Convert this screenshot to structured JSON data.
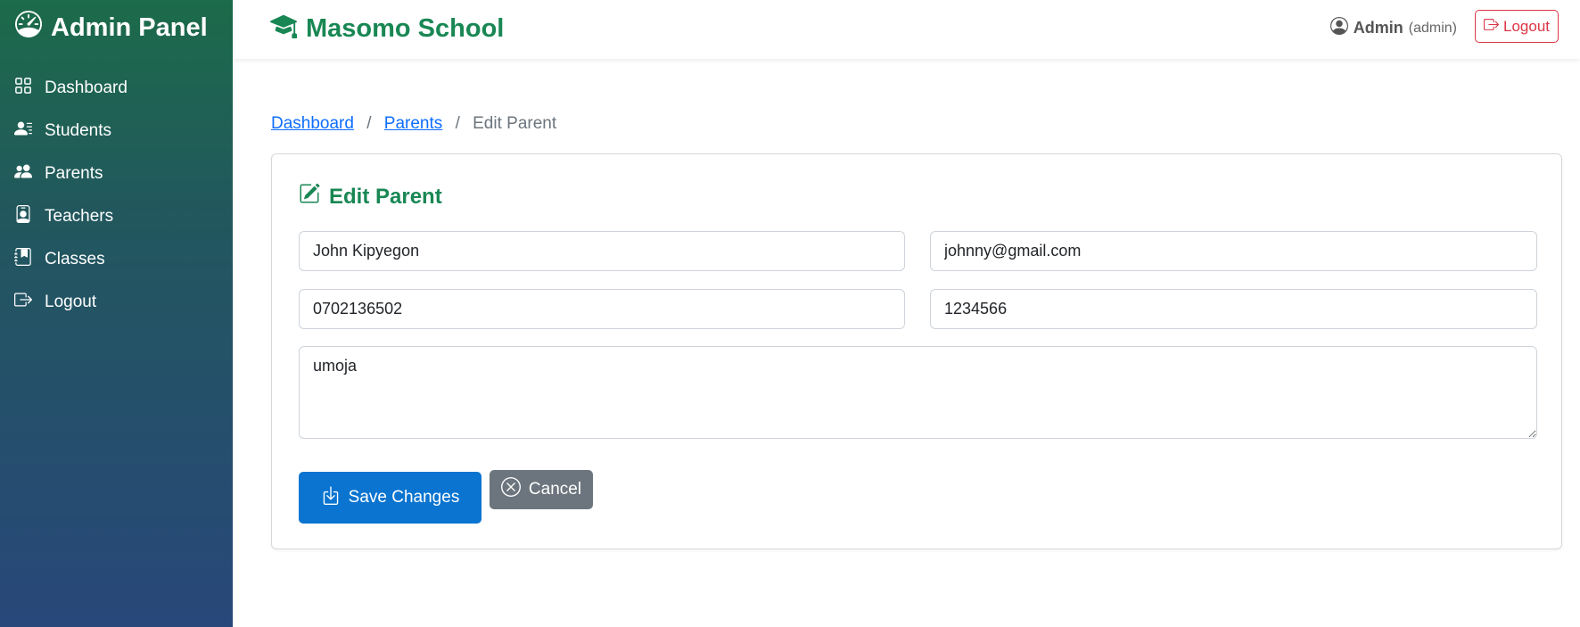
{
  "sidebar": {
    "brand_icon": "speedometer-icon",
    "brand": "Admin Panel",
    "items": [
      {
        "label": "Dashboard",
        "icon": "grid-icon"
      },
      {
        "label": "Students",
        "icon": "person-lines-icon"
      },
      {
        "label": "Parents",
        "icon": "people-icon"
      },
      {
        "label": "Teachers",
        "icon": "person-badge-icon"
      },
      {
        "label": "Classes",
        "icon": "journal-icon"
      },
      {
        "label": "Logout",
        "icon": "box-arrow-right-icon"
      }
    ]
  },
  "header": {
    "school_icon": "mortarboard-icon",
    "school_name": "Masomo School",
    "user_icon": "person-circle-icon",
    "user_name": "Admin",
    "user_role": "(admin)",
    "logout_label": "Logout"
  },
  "breadcrumb": {
    "items": [
      "Dashboard",
      "Parents"
    ],
    "separator": "/",
    "current": "Edit Parent"
  },
  "form": {
    "title": "Edit Parent",
    "title_icon": "pencil-square-icon",
    "name": "John Kipyegon",
    "email": "johnny@gmail.com",
    "phone": "0702136502",
    "id_number": "1234566",
    "address": "umoja",
    "save_label": "Save Changes",
    "cancel_label": "Cancel"
  },
  "colors": {
    "brand_green": "#198754",
    "primary": "#0a74d0",
    "secondary": "#6c757d",
    "danger": "#dc3545",
    "link": "#0d6efd"
  }
}
